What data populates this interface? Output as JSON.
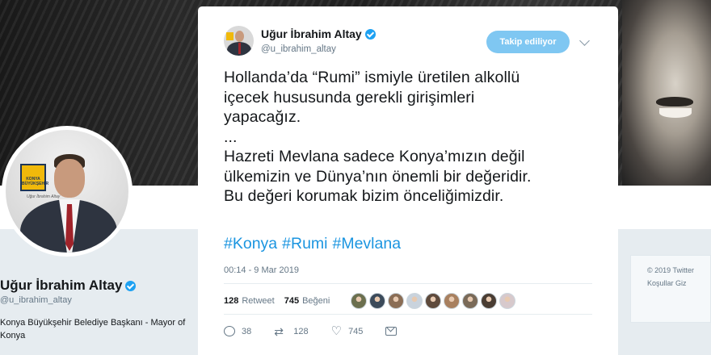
{
  "profile": {
    "name": "Uğur İbrahim Altay",
    "handle": "@u_ibrahim_altay",
    "bio": "Konya Büyükşehir Belediye Başkanı - Mayor of Konya",
    "logo_text": "KONYA BÜYÜKŞEHİR",
    "signature": "Uğur İbrahim Altay",
    "footer_line1": "© 2019 Twitter",
    "footer_line2": "Koşullar   Giz"
  },
  "tweet": {
    "author_name": "Uğur İbrahim Altay",
    "author_handle": "@u_ibrahim_altay",
    "follow_label": "Takip ediliyor",
    "lines": [
      "Hollanda’da “Rumi” ismiyle üretilen alkollü",
      "içecek hususunda gerekli girişimleri",
      "yapacağız.",
      "...",
      "Hazreti Mevlana sadece Konya’mızın değil",
      "ülkemizin ve Dünya’nın önemli bir değeridir.",
      "Bu değeri korumak bizim önceliğimizdir."
    ],
    "hashtags": [
      "#Konya",
      "#Rumi",
      "#Mevlana"
    ],
    "timestamp": "00:14 - 9 Mar 2019",
    "retweet_count": "128",
    "retweet_label": "Retweet",
    "like_count": "745",
    "like_label": "Beğeni",
    "actions": {
      "reply_count": "38",
      "retweet_count": "128",
      "like_count": "745"
    },
    "liker_colors": [
      "#6b6f4e",
      "#3b4a5a",
      "#8a6d55",
      "#c9d3dd",
      "#5e4a3c",
      "#a8805f",
      "#7a6a58",
      "#4a3d33",
      "#d7c9cc"
    ]
  },
  "colors": {
    "accent": "#1da1f2",
    "follow_button": "#7fc7f2",
    "hashtag": "#1b95e0"
  }
}
